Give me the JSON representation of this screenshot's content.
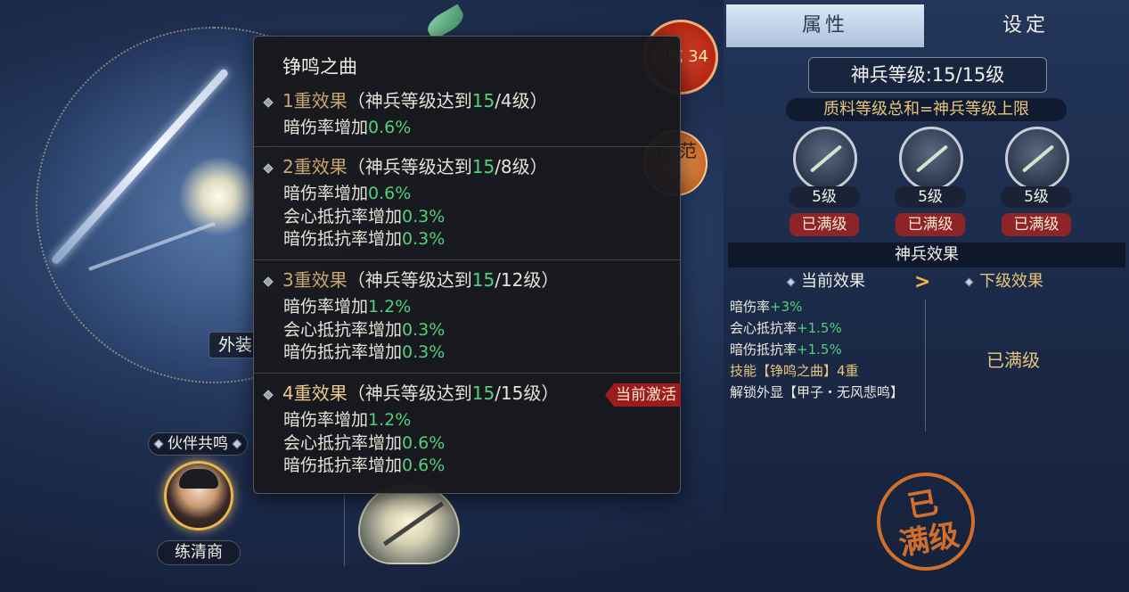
{
  "scene": {
    "outfit_tag": "外装",
    "partner_header": "伙伴共鸣",
    "partner_name": "练清商",
    "seal_red_text": "加成 34",
    "seal_orange_text": "性 范"
  },
  "tooltip": {
    "title": "铮鸣之曲",
    "tiers": [
      {
        "label": "1重效果",
        "cond_prefix": "（神兵等级达到",
        "cond_cur": "15",
        "cond_req": "/4级",
        "cond_suffix": "）",
        "lines": [
          {
            "text": "暗伤率增加",
            "value": "0.6%"
          }
        ]
      },
      {
        "label": "2重效果",
        "cond_prefix": "（神兵等级达到",
        "cond_cur": "15",
        "cond_req": "/8级",
        "cond_suffix": "）",
        "lines": [
          {
            "text": "暗伤率增加",
            "value": "0.6%"
          },
          {
            "text": "会心抵抗率增加",
            "value": "0.3%"
          },
          {
            "text": "暗伤抵抗率增加",
            "value": "0.3%"
          }
        ]
      },
      {
        "label": "3重效果",
        "cond_prefix": "（神兵等级达到",
        "cond_cur": "15",
        "cond_req": "/12级",
        "cond_suffix": "）",
        "lines": [
          {
            "text": "暗伤率增加",
            "value": "1.2%"
          },
          {
            "text": "会心抵抗率增加",
            "value": "0.3%"
          },
          {
            "text": "暗伤抵抗率增加",
            "value": "0.3%"
          }
        ]
      },
      {
        "label": "4重效果",
        "cond_prefix": "（神兵等级达到",
        "cond_cur": "15",
        "cond_req": "/15级",
        "cond_suffix": "）",
        "badge": "当前激活",
        "lines": [
          {
            "text": "暗伤率增加",
            "value": "1.2%"
          },
          {
            "text": "会心抵抗率增加",
            "value": "0.6%"
          },
          {
            "text": "暗伤抵抗率增加",
            "value": "0.6%"
          }
        ]
      }
    ]
  },
  "panel": {
    "tabs": [
      "属性",
      "设定"
    ],
    "level_text": "神兵等级:15/15级",
    "rule_text": "质料等级总和=神兵等级上限",
    "slots": [
      {
        "level": "5级",
        "status": "已满级"
      },
      {
        "level": "5级",
        "status": "已满级"
      },
      {
        "level": "5级",
        "status": "已满级"
      }
    ],
    "effect_title": "神兵效果",
    "current_title": "当前效果",
    "next_title": "下级效果",
    "current_effects": [
      {
        "text": "暗伤率",
        "value": "+3%"
      },
      {
        "text": "会心抵抗率",
        "value": "+1.5%"
      },
      {
        "text": "暗伤抵抗率",
        "value": "+1.5%"
      },
      {
        "text": "技能【铮鸣之曲】4重",
        "value": ""
      },
      {
        "text": "解锁外显【甲子・无风悲鸣】",
        "value": ""
      }
    ],
    "next_effect": "已满级",
    "stamp_line1": "已",
    "stamp_line2": "满级"
  },
  "colors": {
    "accent_green": "#4fd27b",
    "accent_gold": "#e7c57a",
    "badge_red": "#9a1d1d",
    "stamp_orange": "#e0762b"
  }
}
